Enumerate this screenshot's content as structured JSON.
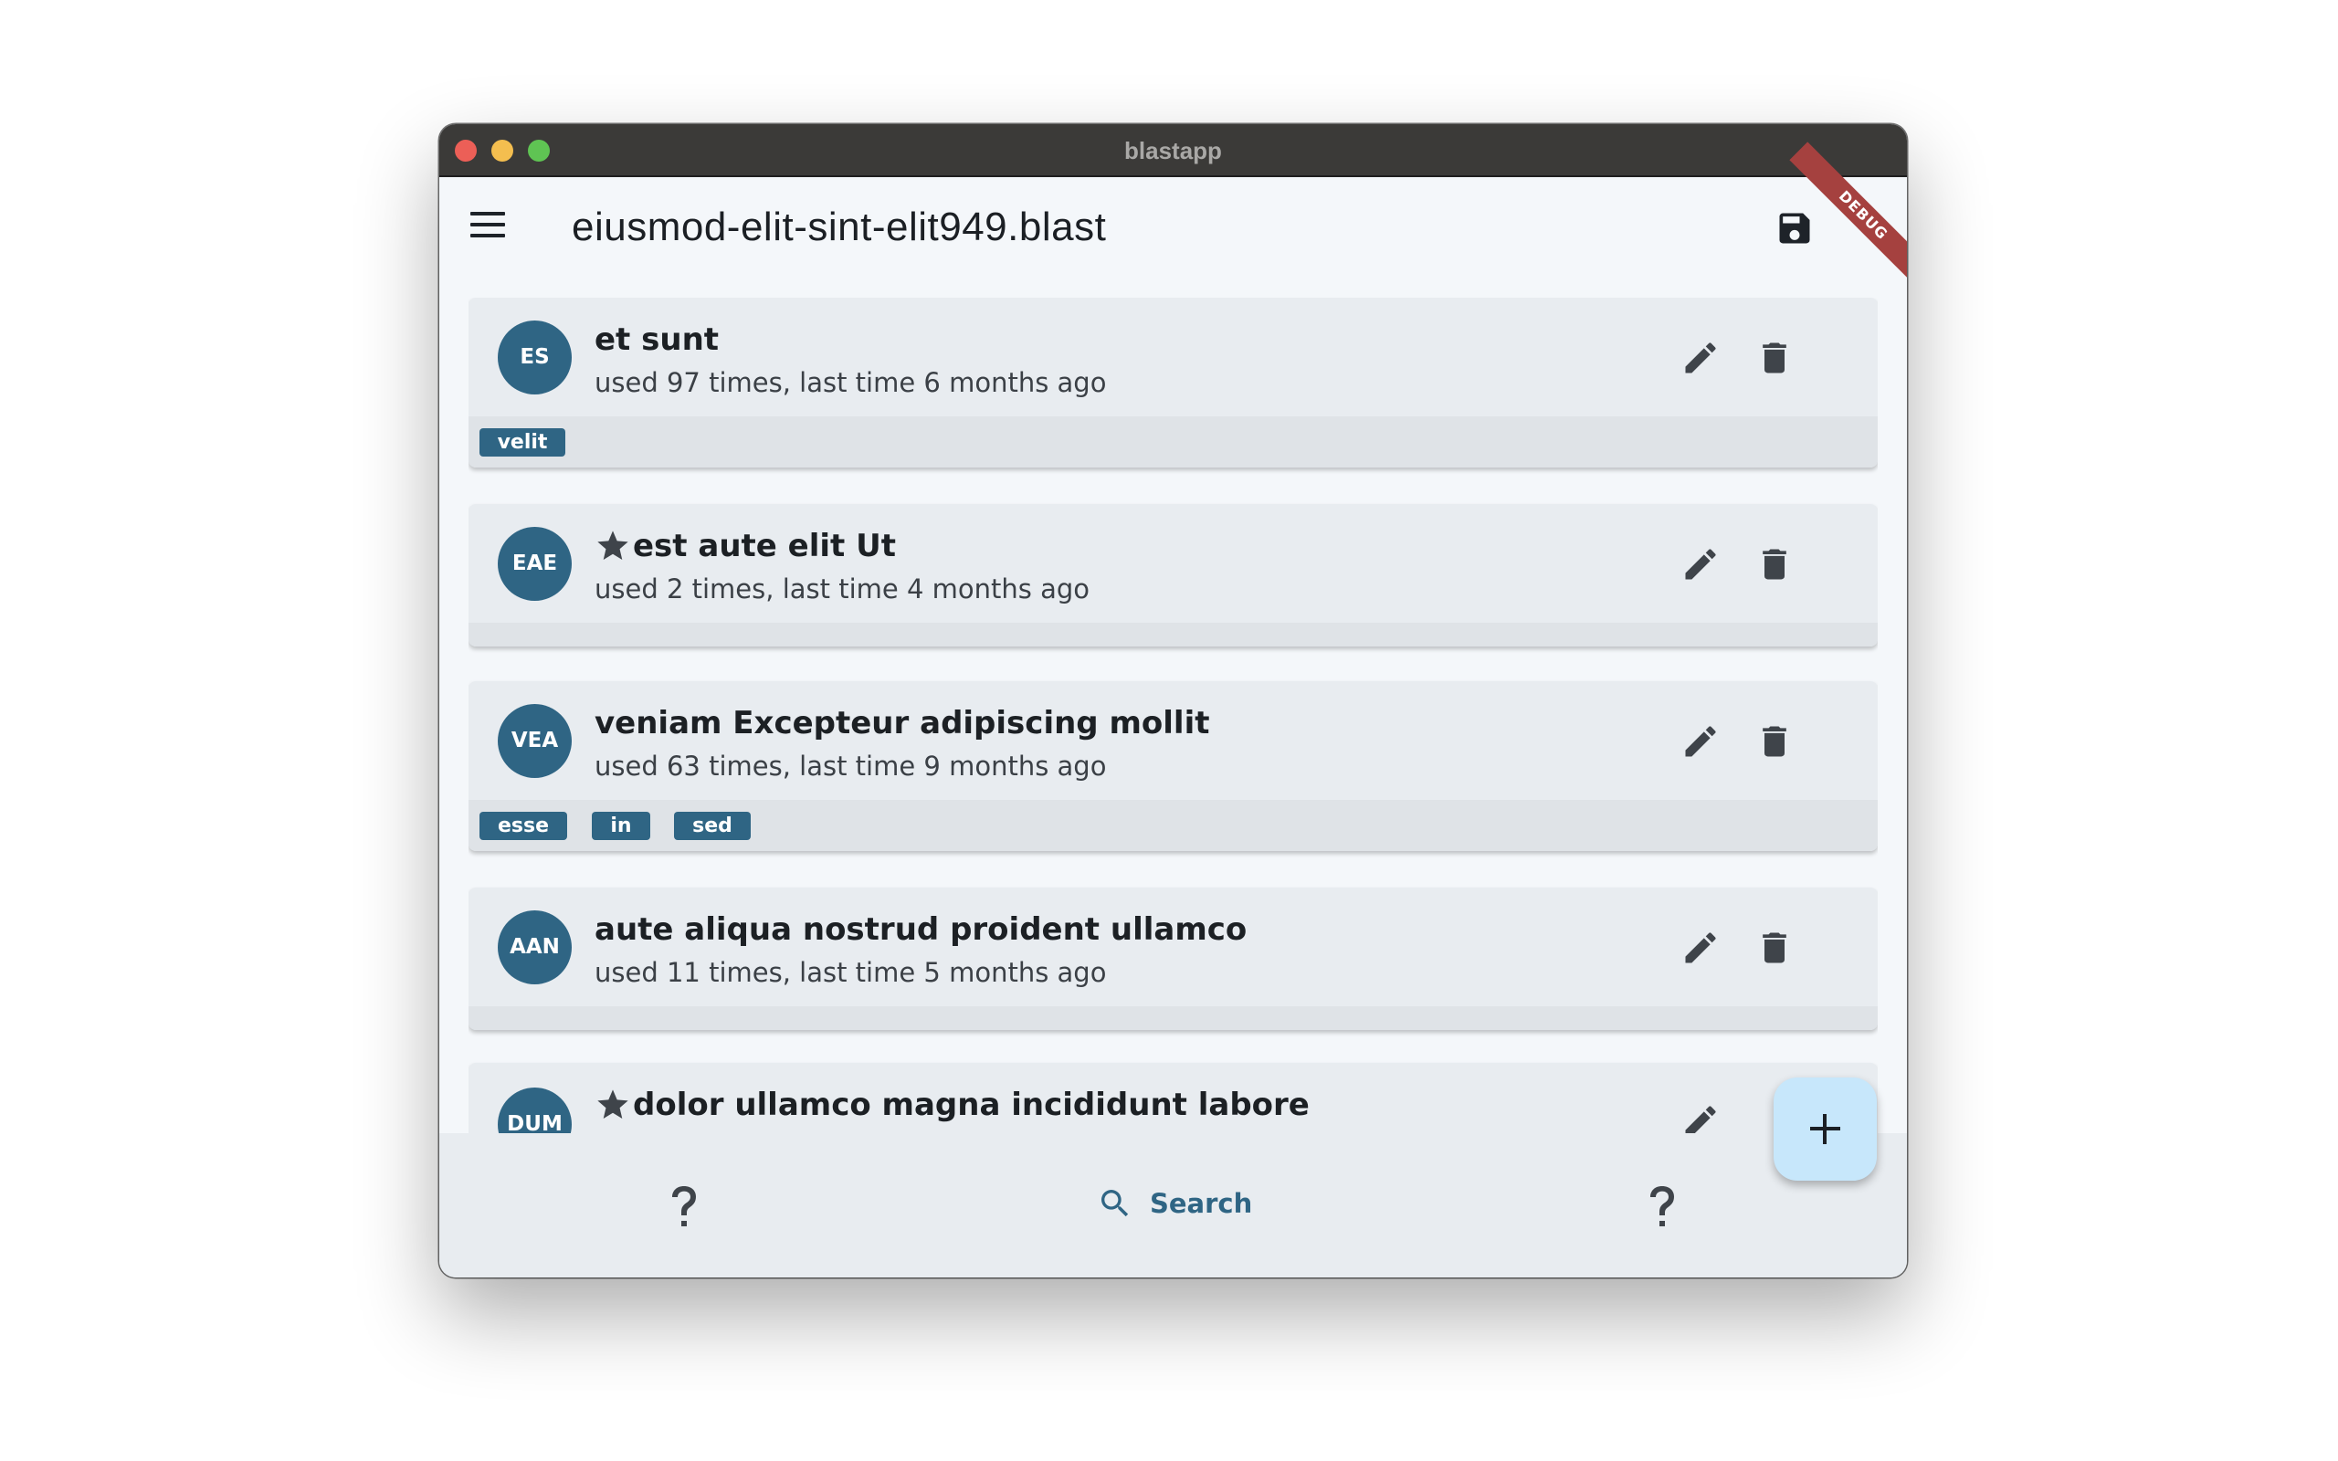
{
  "window": {
    "title": "blastapp"
  },
  "appbar": {
    "file_title": "eiusmod-elit-sint-elit949.blast",
    "debug_label": "DEBUG"
  },
  "items": [
    {
      "initials": "ES",
      "title": "et sunt",
      "starred": false,
      "subtitle": "used 97 times, last time 6 months ago",
      "tags": [
        "velit"
      ]
    },
    {
      "initials": "EAE",
      "title": "est aute elit Ut",
      "starred": true,
      "subtitle": "used 2 times, last time 4 months ago",
      "tags": []
    },
    {
      "initials": "VEA",
      "title": "veniam Excepteur adipiscing mollit",
      "starred": false,
      "subtitle": "used 63 times, last time 9 months ago",
      "tags": [
        "esse",
        "in",
        "sed"
      ]
    },
    {
      "initials": "AAN",
      "title": "aute aliqua nostrud proident ullamco",
      "starred": false,
      "subtitle": "used 11 times, last time 5 months ago",
      "tags": []
    },
    {
      "initials": "DUM",
      "title": "dolor ullamco magna incididunt labore",
      "starred": true,
      "subtitle": "",
      "tags": []
    }
  ],
  "bottom_nav": {
    "left_icon": "help-icon",
    "search_label": "Search",
    "right_icon": "help-icon"
  },
  "fab": {
    "icon": "add-icon"
  },
  "colors": {
    "accent": "#2f6584",
    "titlebar": "#3b3a38",
    "card": "#e8ecf0",
    "fab": "#c7e7fb",
    "debug_ribbon": "#a5413f"
  }
}
